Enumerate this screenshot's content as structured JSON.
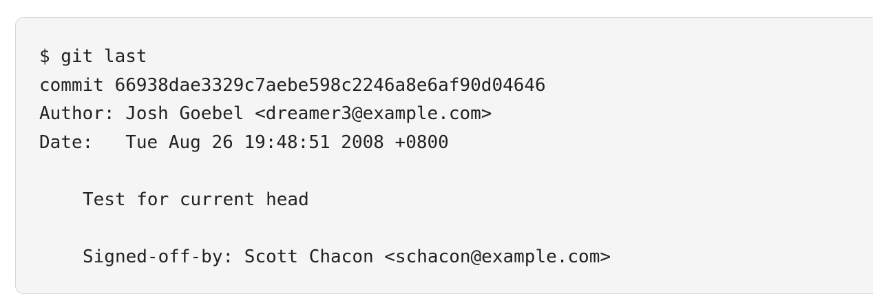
{
  "terminal": {
    "lines": [
      "$ git last",
      "commit 66938dae3329c7aebe598c2246a8e6af90d04646",
      "Author: Josh Goebel <dreamer3@example.com>",
      "Date:   Tue Aug 26 19:48:51 2008 +0800",
      "",
      "Test for current head",
      "",
      "Signed-off-by: Scott Chacon <schacon@example.com>"
    ]
  },
  "colors": {
    "background": "#f5f5f5",
    "border": "#d6d6d6",
    "text": "#222222"
  }
}
